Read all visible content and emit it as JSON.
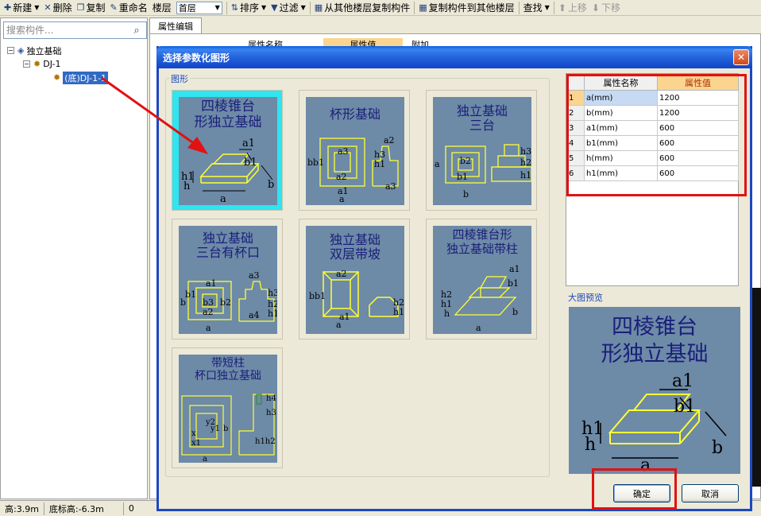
{
  "toolbar": {
    "new": "新建",
    "delete": "删除",
    "copy": "复制",
    "rename": "重命名",
    "floor": "楼层",
    "floor_value": "首层",
    "sort": "排序",
    "filter": "过滤",
    "copy_from_other": "从其他楼层复制构件",
    "copy_to_other": "复制构件到其他楼层",
    "find": "查找",
    "move_up": "上移",
    "move_down": "下移"
  },
  "left": {
    "search_placeholder": "搜索构件...",
    "tree": {
      "root": "独立基础",
      "child": "DJ-1",
      "leaf": "(底)DJ-1-1"
    }
  },
  "main": {
    "tab": "属性编辑",
    "col_name": "属性名称",
    "col_value": "属性值",
    "col_extra": "附加"
  },
  "status": {
    "floor_height": "高:3.9m",
    "bottom_elev": "底标高:-6.3m",
    "count": "0"
  },
  "dialog": {
    "title": "选择参数化图形",
    "group_shapes": "图形",
    "group_preview": "大图预览",
    "ok": "确定",
    "cancel": "取消",
    "shapes": [
      {
        "l1": "四棱锥台",
        "l2": "形独立基础"
      },
      {
        "l1": "杯形基础",
        "l2": ""
      },
      {
        "l1": "独立基础",
        "l2": "三台"
      },
      {
        "l1": "独立基础",
        "l2": "三台有杯口"
      },
      {
        "l1": "独立基础",
        "l2": "双层带坡"
      },
      {
        "l1": "四棱锥台形",
        "l2": "独立基础带柱"
      },
      {
        "l1": "带短柱",
        "l2": "杯口独立基础"
      }
    ],
    "props": {
      "col_name": "属性名称",
      "col_value": "属性值",
      "rows": [
        {
          "n": "1",
          "name": "a(mm)",
          "value": "1200"
        },
        {
          "n": "2",
          "name": "b(mm)",
          "value": "1200"
        },
        {
          "n": "3",
          "name": "a1(mm)",
          "value": "600"
        },
        {
          "n": "4",
          "name": "b1(mm)",
          "value": "600"
        },
        {
          "n": "5",
          "name": "h(mm)",
          "value": "600"
        },
        {
          "n": "6",
          "name": "h1(mm)",
          "value": "600"
        }
      ]
    },
    "preview": {
      "l1": "四棱锥台",
      "l2": "形独立基础"
    },
    "dims": {
      "a": "a",
      "b": "b",
      "a1": "a1",
      "b1": "b1",
      "h": "h",
      "h1": "h1"
    }
  }
}
